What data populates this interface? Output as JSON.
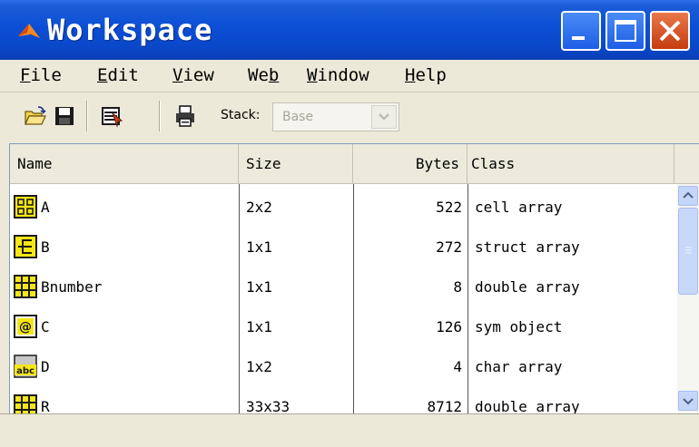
{
  "window": {
    "title": "Workspace"
  },
  "menu": [
    {
      "pre": "",
      "ul": "F",
      "post": "ile"
    },
    {
      "pre": "",
      "ul": "E",
      "post": "dit"
    },
    {
      "pre": "",
      "ul": "V",
      "post": "iew"
    },
    {
      "pre": "We",
      "ul": "b",
      "post": ""
    },
    {
      "pre": "",
      "ul": "W",
      "post": "indow"
    },
    {
      "pre": "",
      "ul": "H",
      "post": "elp"
    }
  ],
  "toolbar": {
    "icons": [
      "open-folder-icon",
      "save-icon",
      "import-data-icon",
      "print-icon"
    ],
    "stack_label": "Stack:",
    "stack_value": "Base"
  },
  "table": {
    "columns": [
      "Name",
      "Size",
      "Bytes",
      "Class"
    ],
    "rows": [
      {
        "icon": "cell-array-icon",
        "name": "A",
        "size": "2x2",
        "bytes": "522",
        "class": "cell array"
      },
      {
        "icon": "struct-array-icon",
        "name": "B",
        "size": "1x1",
        "bytes": "272",
        "class": "struct array"
      },
      {
        "icon": "double-array-icon",
        "name": "Bnumber",
        "size": "1x1",
        "bytes": "8",
        "class": "double array"
      },
      {
        "icon": "sym-object-icon",
        "name": "C",
        "size": "1x1",
        "bytes": "126",
        "class": "sym object"
      },
      {
        "icon": "char-array-icon",
        "name": "D",
        "size": "1x2",
        "bytes": "4",
        "class": "char array"
      },
      {
        "icon": "double-array-icon",
        "name": "R",
        "size": "33x33",
        "bytes": "8712",
        "class": "double array"
      }
    ]
  },
  "icon_text": {
    "sym": "@",
    "char": "abc"
  }
}
